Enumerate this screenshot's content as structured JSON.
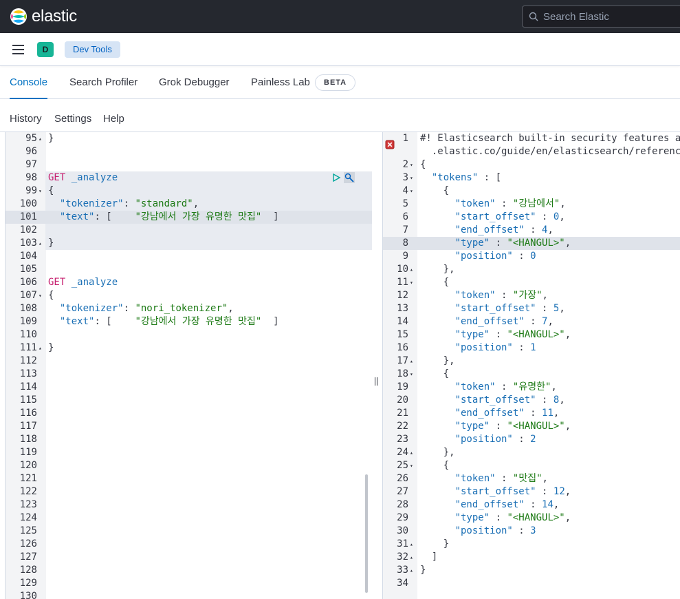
{
  "header": {
    "brand": "elastic",
    "search_placeholder": "Search Elastic"
  },
  "nav": {
    "space_initial": "D",
    "breadcrumb": "Dev Tools"
  },
  "tabs": [
    {
      "label": "Console",
      "active": true
    },
    {
      "label": "Search Profiler",
      "active": false
    },
    {
      "label": "Grok Debugger",
      "active": false
    },
    {
      "label": "Painless Lab",
      "active": false
    }
  ],
  "beta_badge": "BETA",
  "console_menu": [
    "History",
    "Settings",
    "Help"
  ],
  "request_editor": {
    "lines": [
      {
        "n": "95",
        "fold": "▴",
        "tokens": [
          [
            "}",
            "p"
          ]
        ]
      },
      {
        "n": "96",
        "fold": "",
        "tokens": []
      },
      {
        "n": "97",
        "fold": "",
        "tokens": []
      },
      {
        "n": "98",
        "fold": "",
        "tokens": [
          [
            "GET",
            "m"
          ],
          [
            " _analyze",
            "u"
          ]
        ],
        "hl": true
      },
      {
        "n": "99",
        "fold": "▾",
        "tokens": [
          [
            "{",
            "p"
          ]
        ],
        "hl": true
      },
      {
        "n": "100",
        "fold": "",
        "tokens": [
          [
            "  ",
            "p"
          ],
          [
            "\"tokenizer\"",
            "k"
          ],
          [
            ": ",
            "p"
          ],
          [
            "\"standard\"",
            "s"
          ],
          [
            ",",
            "p"
          ]
        ],
        "hl": true
      },
      {
        "n": "101",
        "fold": "",
        "tokens": [
          [
            "  ",
            "p"
          ],
          [
            "\"text\"",
            "k"
          ],
          [
            ": [    ",
            "p"
          ],
          [
            "\"강남에서 가장 유명한 맛집\"",
            "s"
          ],
          [
            "  ]",
            "p"
          ]
        ],
        "hl": true,
        "active": true
      },
      {
        "n": "102",
        "fold": "",
        "tokens": [],
        "hl": true
      },
      {
        "n": "103",
        "fold": "▴",
        "tokens": [
          [
            "}",
            "p"
          ]
        ],
        "hl": true
      },
      {
        "n": "104",
        "fold": "",
        "tokens": []
      },
      {
        "n": "105",
        "fold": "",
        "tokens": []
      },
      {
        "n": "106",
        "fold": "",
        "tokens": [
          [
            "GET",
            "m"
          ],
          [
            " _analyze",
            "u"
          ]
        ]
      },
      {
        "n": "107",
        "fold": "▾",
        "tokens": [
          [
            "{",
            "p"
          ]
        ]
      },
      {
        "n": "108",
        "fold": "",
        "tokens": [
          [
            "  ",
            "p"
          ],
          [
            "\"tokenizer\"",
            "k"
          ],
          [
            ": ",
            "p"
          ],
          [
            "\"nori_tokenizer\"",
            "s"
          ],
          [
            ",",
            "p"
          ]
        ]
      },
      {
        "n": "109",
        "fold": "",
        "tokens": [
          [
            "  ",
            "p"
          ],
          [
            "\"text\"",
            "k"
          ],
          [
            ": [    ",
            "p"
          ],
          [
            "\"강남에서 가장 유명한 맛집\"",
            "s"
          ],
          [
            "  ]",
            "p"
          ]
        ]
      },
      {
        "n": "110",
        "fold": "",
        "tokens": []
      },
      {
        "n": "111",
        "fold": "▴",
        "tokens": [
          [
            "}",
            "p"
          ]
        ]
      },
      {
        "n": "112",
        "fold": "",
        "tokens": []
      },
      {
        "n": "113",
        "fold": "",
        "tokens": []
      },
      {
        "n": "114",
        "fold": "",
        "tokens": []
      },
      {
        "n": "115",
        "fold": "",
        "tokens": []
      },
      {
        "n": "116",
        "fold": "",
        "tokens": []
      },
      {
        "n": "117",
        "fold": "",
        "tokens": []
      },
      {
        "n": "118",
        "fold": "",
        "tokens": []
      },
      {
        "n": "119",
        "fold": "",
        "tokens": []
      },
      {
        "n": "120",
        "fold": "",
        "tokens": []
      },
      {
        "n": "121",
        "fold": "",
        "tokens": []
      },
      {
        "n": "122",
        "fold": "",
        "tokens": []
      },
      {
        "n": "123",
        "fold": "",
        "tokens": []
      },
      {
        "n": "124",
        "fold": "",
        "tokens": []
      },
      {
        "n": "125",
        "fold": "",
        "tokens": []
      },
      {
        "n": "126",
        "fold": "",
        "tokens": []
      },
      {
        "n": "127",
        "fold": "",
        "tokens": []
      },
      {
        "n": "128",
        "fold": "",
        "tokens": []
      },
      {
        "n": "129",
        "fold": "",
        "tokens": []
      },
      {
        "n": "130",
        "fold": "",
        "tokens": []
      }
    ]
  },
  "response_editor": {
    "lines": [
      {
        "n": "1",
        "fold": "",
        "tokens": [
          [
            "#! Elasticsearch built-in security features a",
            "c"
          ]
        ]
      },
      {
        "n": "",
        "fold": "",
        "tokens": [
          [
            "  .elastic.co/guide/en/elasticsearch/referenc",
            "c"
          ]
        ]
      },
      {
        "n": "2",
        "fold": "▾",
        "tokens": [
          [
            "{",
            "p"
          ]
        ]
      },
      {
        "n": "3",
        "fold": "▾",
        "tokens": [
          [
            "  ",
            "p"
          ],
          [
            "\"tokens\"",
            "k"
          ],
          [
            " : [",
            "p"
          ]
        ]
      },
      {
        "n": "4",
        "fold": "▾",
        "tokens": [
          [
            "    {",
            "p"
          ]
        ]
      },
      {
        "n": "5",
        "fold": "",
        "tokens": [
          [
            "      ",
            "p"
          ],
          [
            "\"token\"",
            "k"
          ],
          [
            " : ",
            "p"
          ],
          [
            "\"강남에서\"",
            "s"
          ],
          [
            ",",
            "p"
          ]
        ]
      },
      {
        "n": "6",
        "fold": "",
        "tokens": [
          [
            "      ",
            "p"
          ],
          [
            "\"start_offset\"",
            "k"
          ],
          [
            " : ",
            "p"
          ],
          [
            "0",
            "n"
          ],
          [
            ",",
            "p"
          ]
        ]
      },
      {
        "n": "7",
        "fold": "",
        "tokens": [
          [
            "      ",
            "p"
          ],
          [
            "\"end_offset\"",
            "k"
          ],
          [
            " : ",
            "p"
          ],
          [
            "4",
            "n"
          ],
          [
            ",",
            "p"
          ]
        ]
      },
      {
        "n": "8",
        "fold": "",
        "tokens": [
          [
            "      ",
            "p"
          ],
          [
            "\"type\"",
            "k"
          ],
          [
            " : ",
            "p"
          ],
          [
            "\"<HANGUL>\"",
            "s"
          ],
          [
            ",",
            "p"
          ]
        ],
        "active": true
      },
      {
        "n": "9",
        "fold": "",
        "tokens": [
          [
            "      ",
            "p"
          ],
          [
            "\"position\"",
            "k"
          ],
          [
            " : ",
            "p"
          ],
          [
            "0",
            "n"
          ]
        ]
      },
      {
        "n": "10",
        "fold": "▴",
        "tokens": [
          [
            "    },",
            "p"
          ]
        ]
      },
      {
        "n": "11",
        "fold": "▾",
        "tokens": [
          [
            "    {",
            "p"
          ]
        ]
      },
      {
        "n": "12",
        "fold": "",
        "tokens": [
          [
            "      ",
            "p"
          ],
          [
            "\"token\"",
            "k"
          ],
          [
            " : ",
            "p"
          ],
          [
            "\"가장\"",
            "s"
          ],
          [
            ",",
            "p"
          ]
        ]
      },
      {
        "n": "13",
        "fold": "",
        "tokens": [
          [
            "      ",
            "p"
          ],
          [
            "\"start_offset\"",
            "k"
          ],
          [
            " : ",
            "p"
          ],
          [
            "5",
            "n"
          ],
          [
            ",",
            "p"
          ]
        ]
      },
      {
        "n": "14",
        "fold": "",
        "tokens": [
          [
            "      ",
            "p"
          ],
          [
            "\"end_offset\"",
            "k"
          ],
          [
            " : ",
            "p"
          ],
          [
            "7",
            "n"
          ],
          [
            ",",
            "p"
          ]
        ]
      },
      {
        "n": "15",
        "fold": "",
        "tokens": [
          [
            "      ",
            "p"
          ],
          [
            "\"type\"",
            "k"
          ],
          [
            " : ",
            "p"
          ],
          [
            "\"<HANGUL>\"",
            "s"
          ],
          [
            ",",
            "p"
          ]
        ]
      },
      {
        "n": "16",
        "fold": "",
        "tokens": [
          [
            "      ",
            "p"
          ],
          [
            "\"position\"",
            "k"
          ],
          [
            " : ",
            "p"
          ],
          [
            "1",
            "n"
          ]
        ]
      },
      {
        "n": "17",
        "fold": "▴",
        "tokens": [
          [
            "    },",
            "p"
          ]
        ]
      },
      {
        "n": "18",
        "fold": "▾",
        "tokens": [
          [
            "    {",
            "p"
          ]
        ]
      },
      {
        "n": "19",
        "fold": "",
        "tokens": [
          [
            "      ",
            "p"
          ],
          [
            "\"token\"",
            "k"
          ],
          [
            " : ",
            "p"
          ],
          [
            "\"유명한\"",
            "s"
          ],
          [
            ",",
            "p"
          ]
        ]
      },
      {
        "n": "20",
        "fold": "",
        "tokens": [
          [
            "      ",
            "p"
          ],
          [
            "\"start_offset\"",
            "k"
          ],
          [
            " : ",
            "p"
          ],
          [
            "8",
            "n"
          ],
          [
            ",",
            "p"
          ]
        ]
      },
      {
        "n": "21",
        "fold": "",
        "tokens": [
          [
            "      ",
            "p"
          ],
          [
            "\"end_offset\"",
            "k"
          ],
          [
            " : ",
            "p"
          ],
          [
            "11",
            "n"
          ],
          [
            ",",
            "p"
          ]
        ]
      },
      {
        "n": "22",
        "fold": "",
        "tokens": [
          [
            "      ",
            "p"
          ],
          [
            "\"type\"",
            "k"
          ],
          [
            " : ",
            "p"
          ],
          [
            "\"<HANGUL>\"",
            "s"
          ],
          [
            ",",
            "p"
          ]
        ]
      },
      {
        "n": "23",
        "fold": "",
        "tokens": [
          [
            "      ",
            "p"
          ],
          [
            "\"position\"",
            "k"
          ],
          [
            " : ",
            "p"
          ],
          [
            "2",
            "n"
          ]
        ]
      },
      {
        "n": "24",
        "fold": "▴",
        "tokens": [
          [
            "    },",
            "p"
          ]
        ]
      },
      {
        "n": "25",
        "fold": "▾",
        "tokens": [
          [
            "    {",
            "p"
          ]
        ]
      },
      {
        "n": "26",
        "fold": "",
        "tokens": [
          [
            "      ",
            "p"
          ],
          [
            "\"token\"",
            "k"
          ],
          [
            " : ",
            "p"
          ],
          [
            "\"맛집\"",
            "s"
          ],
          [
            ",",
            "p"
          ]
        ]
      },
      {
        "n": "27",
        "fold": "",
        "tokens": [
          [
            "      ",
            "p"
          ],
          [
            "\"start_offset\"",
            "k"
          ],
          [
            " : ",
            "p"
          ],
          [
            "12",
            "n"
          ],
          [
            ",",
            "p"
          ]
        ]
      },
      {
        "n": "28",
        "fold": "",
        "tokens": [
          [
            "      ",
            "p"
          ],
          [
            "\"end_offset\"",
            "k"
          ],
          [
            " : ",
            "p"
          ],
          [
            "14",
            "n"
          ],
          [
            ",",
            "p"
          ]
        ]
      },
      {
        "n": "29",
        "fold": "",
        "tokens": [
          [
            "      ",
            "p"
          ],
          [
            "\"type\"",
            "k"
          ],
          [
            " : ",
            "p"
          ],
          [
            "\"<HANGUL>\"",
            "s"
          ],
          [
            ",",
            "p"
          ]
        ]
      },
      {
        "n": "30",
        "fold": "",
        "tokens": [
          [
            "      ",
            "p"
          ],
          [
            "\"position\"",
            "k"
          ],
          [
            " : ",
            "p"
          ],
          [
            "3",
            "n"
          ]
        ]
      },
      {
        "n": "31",
        "fold": "▴",
        "tokens": [
          [
            "    }",
            "p"
          ]
        ]
      },
      {
        "n": "32",
        "fold": "▴",
        "tokens": [
          [
            "  ]",
            "p"
          ]
        ]
      },
      {
        "n": "33",
        "fold": "▴",
        "tokens": [
          [
            "}",
            "p"
          ]
        ]
      },
      {
        "n": "34",
        "fold": "",
        "tokens": []
      }
    ]
  },
  "colors": {
    "accent": "#0071c2",
    "method": "#c61e6e",
    "key": "#1a6fb5",
    "string": "#1d7a15",
    "space_badge": "#17b596"
  }
}
